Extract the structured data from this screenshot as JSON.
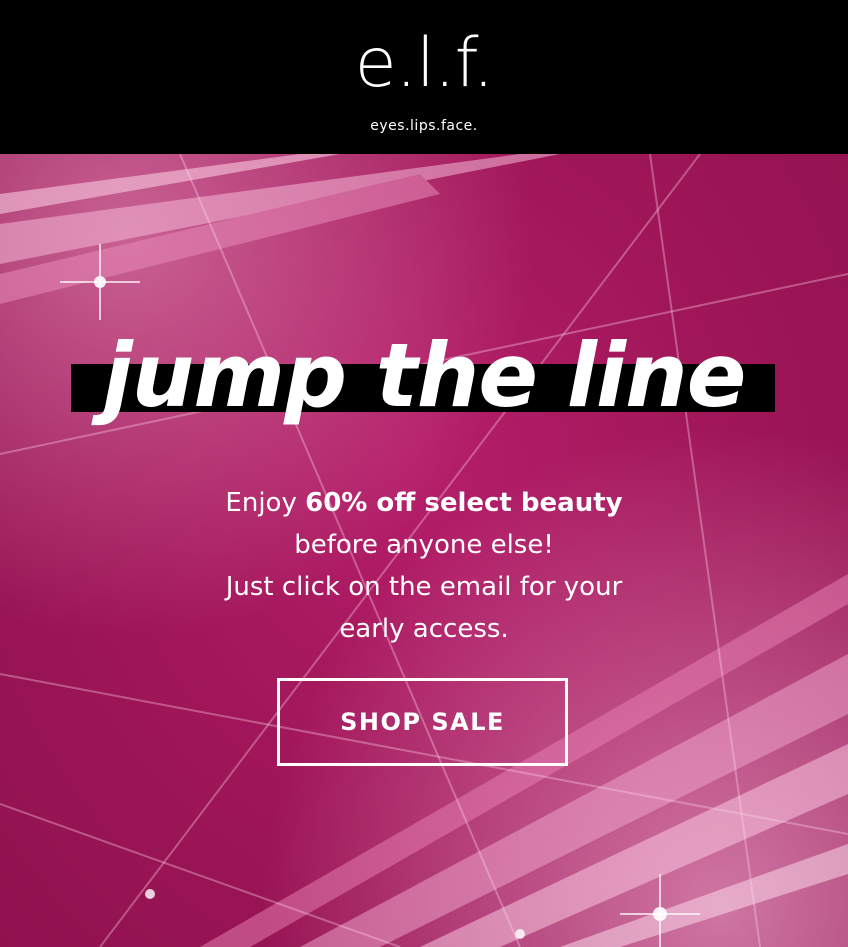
{
  "brand": {
    "logo_text": "e.l.f.",
    "tagline": "eyes.lips.face."
  },
  "hero": {
    "headline": "jump the line",
    "line1_prefix": "Enjoy ",
    "line1_bold": "60% off select beauty",
    "line2": "before anyone else!",
    "line3": "Just click on the email for your",
    "line4": "early access.",
    "cta_label": "SHOP SALE"
  },
  "colors": {
    "header_bg": "#000000",
    "hero_bg": "#a01659",
    "text": "#ffffff",
    "headline_bar": "#000000"
  }
}
